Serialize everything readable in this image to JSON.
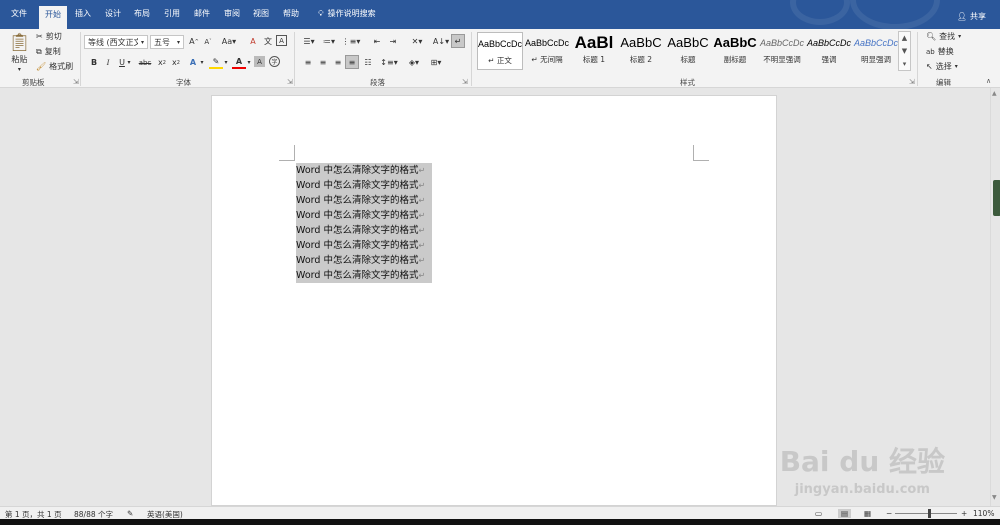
{
  "menubar": {
    "tabs": [
      "文件",
      "开始",
      "插入",
      "设计",
      "布局",
      "引用",
      "邮件",
      "审阅",
      "视图",
      "帮助"
    ],
    "tell_me": "操作说明搜索",
    "share": "共享"
  },
  "ribbon": {
    "clipboard": {
      "paste": "粘贴",
      "cut": "剪切",
      "copy": "复制",
      "format_painter": "格式刷",
      "label": "剪贴板"
    },
    "font": {
      "font_name": "等线 (西文正文)",
      "font_size": "五号",
      "label": "字体"
    },
    "paragraph": {
      "label": "段落"
    },
    "styles": {
      "label": "样式",
      "items": [
        {
          "sample": "AaBbCcDc",
          "name": "↵ 正文"
        },
        {
          "sample": "AaBbCcDc",
          "name": "↵ 无间隔"
        },
        {
          "sample": "AaBl",
          "name": "标题 1"
        },
        {
          "sample": "AaBbC",
          "name": "标题 2"
        },
        {
          "sample": "AaBbC",
          "name": "标题"
        },
        {
          "sample": "AaBbC",
          "name": "副标题"
        },
        {
          "sample": "AaBbCcDc",
          "name": "不明显强调"
        },
        {
          "sample": "AaBbCcDc",
          "name": "强调"
        },
        {
          "sample": "AaBbCcDc",
          "name": "明显强调"
        }
      ]
    },
    "editing": {
      "find": "查找",
      "replace": "替换",
      "select": "选择",
      "label": "编辑"
    }
  },
  "document": {
    "lines": [
      "Word 中怎么清除文字的格式",
      "Word 中怎么清除文字的格式",
      "Word 中怎么清除文字的格式",
      "Word 中怎么清除文字的格式",
      "Word 中怎么清除文字的格式",
      "Word 中怎么清除文字的格式",
      "Word 中怎么清除文字的格式",
      "Word 中怎么清除文字的格式"
    ],
    "paragraph_mark": "↵"
  },
  "status": {
    "page": "第 1 页，共 1 页",
    "words": "88/88 个字",
    "language": "英语(美国)",
    "zoom": "110%"
  },
  "watermark": {
    "line1": "Bai du 经验",
    "line2": "jingyan.baidu.com"
  },
  "colors": {
    "accent": "#2b579a",
    "selection": "#cacaca"
  }
}
